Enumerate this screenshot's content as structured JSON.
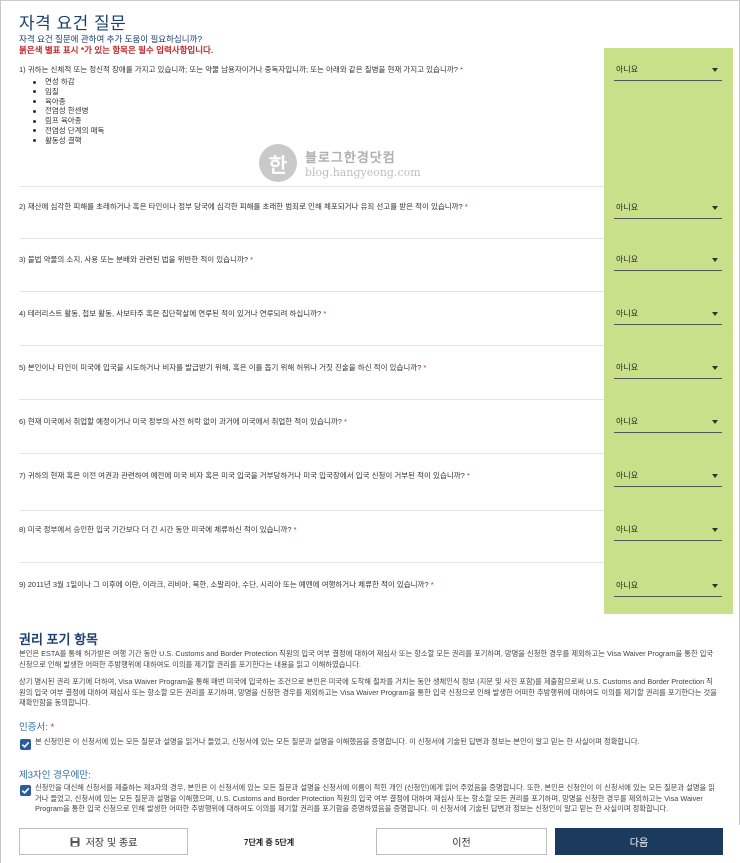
{
  "header": {
    "title": "자격 요건 질문",
    "subtitle": "자격 요건 질문에 관하여 추가 도움이 필요하십니까?",
    "required_note": "붉은색 별표 표시 *가 있는 항목은 필수 입력사항입니다."
  },
  "questions": [
    {
      "text": "1) 귀하는 신체적 또는 정신적 장애를 가지고 있습니까; 또는 약물 남용자이거나 중독자입니까; 또는 아래와 같은 질병을 현재 가지고 있습니까?",
      "asterisk": "*",
      "answer": "아니요"
    },
    {
      "text": "2) 재산에 심각한 피해를 초래하거나 혹은 타인이나 정부 당국에 심각한 피해를 초래한 범죄로 인해 체포되거나 유죄 선고를 받은 적이 있습니까?",
      "asterisk": "*",
      "answer": "아니요"
    },
    {
      "text": "3) 불법 약물의 소지, 사용 또는 분배와 관련된 법을 위반한 적이 있습니까?",
      "asterisk": "*",
      "answer": "아니요"
    },
    {
      "text": "4) 테러리스트 활동, 첩보 활동, 사보타주 혹은 집단학살에 연루된 적이 있거나 연루되려 하십니까?",
      "asterisk": "*",
      "answer": "아니요"
    },
    {
      "text": "5) 본인이나 타인이 미국에 입국을 시도하거나 비자를 발급받기 위해, 혹은 이를 돕기 위해 허위나 거짓 진술을 하신 적이 있습니까?",
      "asterisk": "*",
      "answer": "아니요"
    },
    {
      "text": "6) 현재 미국에서 취업할 예정이거나 미국 정부의 사전 허락 없이 과거에 미국에서 취업한 적이 있습니까?",
      "asterisk": "*",
      "answer": "아니요"
    },
    {
      "text": "7) 귀하의 현재 혹은 이전 여권과 관련하여 예전에 미국 비자 혹은 미국 입국을 거부당하거나 미국 입국장에서 입국 신청이 거부된 적이 있습니까?",
      "asterisk": "*",
      "answer": "아니요"
    },
    {
      "text": "8) 미국 정부에서 승인한 입국 기간보다 더 긴 시간 동안 미국에 체류하신 적이 있습니까?",
      "asterisk": "*",
      "answer": "아니요"
    },
    {
      "text": "9) 2011년 3월 1일이나 그 이후에 이란, 이라크, 리비아, 북한, 소말리아, 수단, 시리아 또는 예멘에 여행하거나 체류한 적이 있습니까?",
      "asterisk": "*",
      "answer": "아니요"
    }
  ],
  "diseases": [
    "연성 하감",
    "임질",
    "육아종",
    "전염성 한센병",
    "림프 육아종",
    "전염성 단계의 매독",
    "활동성 결핵"
  ],
  "watermark": {
    "name": "블로그한경닷컴",
    "url": "blog.hangyeong.com",
    "logo": "한"
  },
  "waiver": {
    "title": "권리 포기 항목",
    "para1": "본인은 ESTA를 통해 허가받은 여행 기간 동안 U.S. Customs and Border Protection 직원의 입국 여부 결정에 대하여 재심사 또는 항소할 모든 권리를 포기하며, 망명을 신청한 경우를 제외하고는 Visa Waiver Program을 통한 입국 신청으로 인해 발생한 어떠한 추방행위에 대하여도 이의를 제기할 권리를 포기한다는 내용을 읽고 이해하였습니다.",
    "para2": "상기 명시된 권리 포기에 더하여, Visa Waiver Program을 통해 매번 미국에 입국하는 조건으로 본인은 미국에 도착해 절차를 거치는 동안 생체인식 정보 (지문 및 사진 포함)를 제출함으로써 U.S. Customs and Border Protection 직원의 입국 여부 결정에 대하여 재심사 또는 항소할 모든 권리를 포기하며, 망명을 신청한 경우를 제외하고는 Visa Waiver Program을 통한 입국 신청으로 인해 발생한 어떠한 추방행위에 대하여도 이의를 제기할 권리를 포기한다는 것을 재확인함을 동의합니다."
  },
  "certification": {
    "label": "인증서:",
    "asterisk": "*",
    "text": "본 신청인은 이 신청서에 있는 모든 질문과 설명을 읽거나 들었고, 신청서에 있는 모든 질문과 설명을 이해했음을 증명합니다. 이 신청서에 기술된 답변과 정보는 본인이 알고 믿는 한 사실이며 정확합니다."
  },
  "third_party": {
    "label": "제3자인 경우에만:",
    "text": "신청인을 대신해 신청서를 제출하는 제3자의 경우, 본인은 이 신청서에 있는 모든 질문과 설명을 신청서에 이름이 적힌 개인 (신청인)에게 읽어 주었음을 증명합니다. 또한, 본인은 신청인이 이 신청서에 있는 모든 질문과 설명을 읽거나 들었고, 신청서에 있는 모든 질문과 설명을 이해했으며, U.S. Customs and Border Protection 직원의 입국 여부 결정에 대하여 재심사 또는 항소할 모든 권리를 포기하며, 망명을 신청한 경우를 제외하고는 Visa Waiver Program을 통한 입국 신청으로 인해 발생한 어떠한 추방행위에 대하여도 이의를 제기할 권리를 포기함을 증명하였음을 증명합니다. 이 신청서에 기술된 답변과 정보는 신청인이 알고 믿는 한 사실이며 정확합니다."
  },
  "footer": {
    "save_label": "저장 및 종료",
    "step": "7단계 중 5단계",
    "prev_label": "이전",
    "next_label": "다음"
  },
  "colors": {
    "highlight": "#c8e08a",
    "title": "#1b3f6e",
    "required": "#c0282d",
    "primary_button": "#1b3a5e"
  }
}
